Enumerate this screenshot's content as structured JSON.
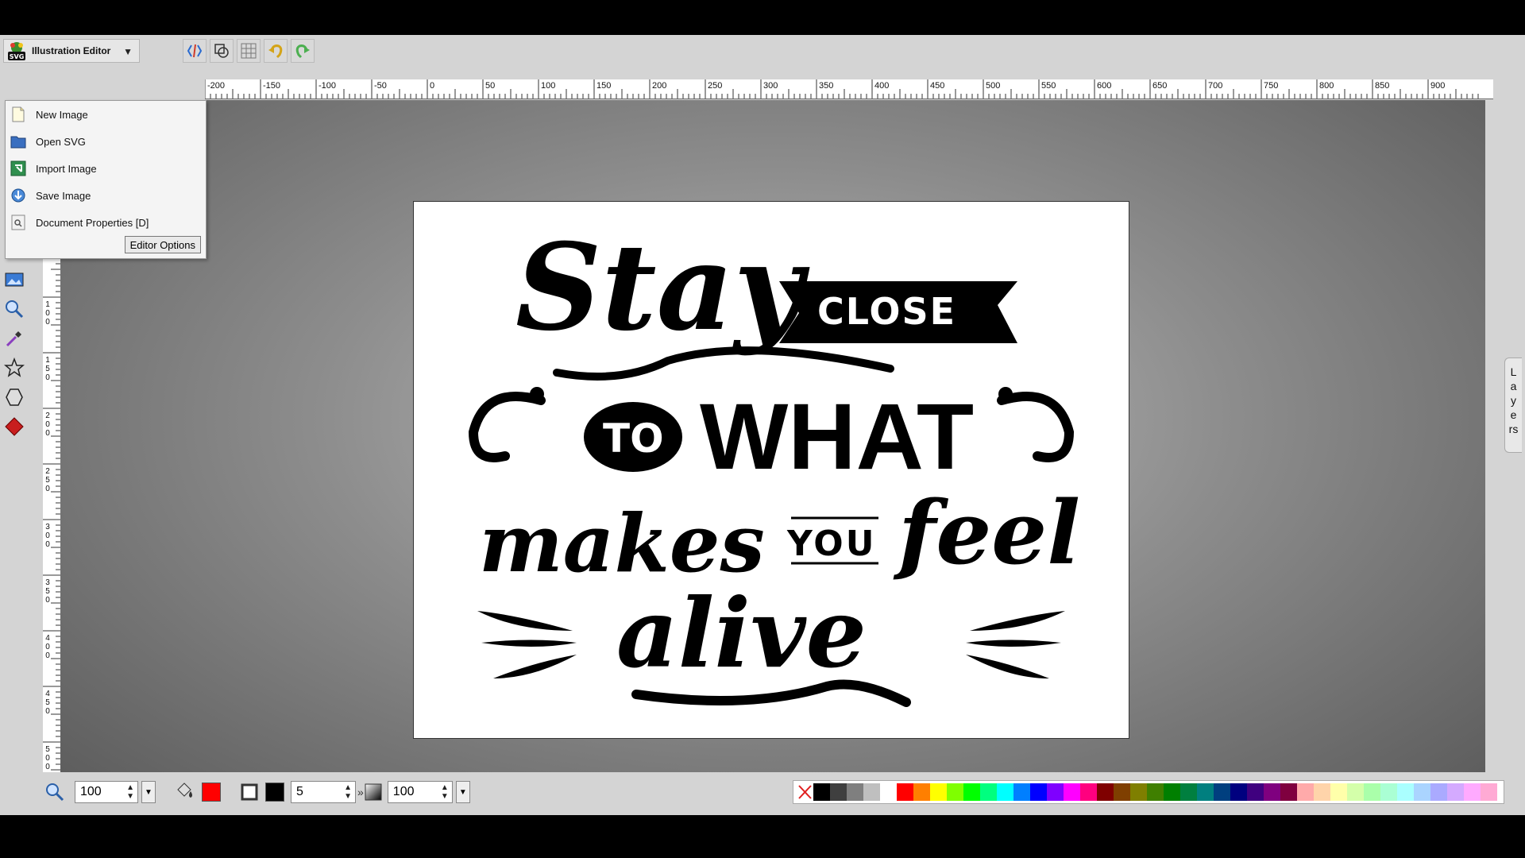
{
  "app": {
    "title": "Illustration Editor",
    "logo_text": "SVG"
  },
  "top_toolbar": {
    "buttons": [
      "source-icon",
      "wireframe-icon",
      "grid-icon",
      "undo-icon",
      "redo-icon"
    ]
  },
  "menu": {
    "items": [
      {
        "label": "New Image",
        "icon": "new-image-icon"
      },
      {
        "label": "Open SVG",
        "icon": "open-folder-icon"
      },
      {
        "label": "Import Image",
        "icon": "import-icon"
      },
      {
        "label": "Save Image",
        "icon": "save-icon"
      },
      {
        "label": "Document Properties [D]",
        "icon": "document-properties-icon"
      }
    ],
    "editor_options_label": "Editor Options"
  },
  "hruler_labels": [
    "-200",
    "-150",
    "-100",
    "-50",
    "0",
    "50",
    "100",
    "150",
    "200",
    "250",
    "300",
    "350",
    "400",
    "450",
    "500",
    "550",
    "600",
    "650",
    "700",
    "750",
    "800",
    "850",
    "900"
  ],
  "vruler_labels": [
    "100",
    "150",
    "200",
    "250",
    "300",
    "350",
    "400",
    "450",
    "500"
  ],
  "canvas": {
    "lettering": {
      "line1a": "Stay",
      "line1b": "CLOSE",
      "line2a": "TO",
      "line2b": "WHAT",
      "line3a": "makes",
      "line3b": "YOU",
      "line3c": "feel",
      "line4": "alive"
    }
  },
  "layers_label": "Layers",
  "bottom_bar": {
    "zoom_value": "100",
    "fill_color": "#ff0000",
    "stroke_color": "#000000",
    "stroke_width": "5",
    "opacity_value": "100"
  },
  "palette": [
    "none",
    "#000000",
    "#3f3f3f",
    "#7f7f7f",
    "#bfbfbf",
    "#ffffff",
    "#ff0000",
    "#ff7f00",
    "#ffff00",
    "#7fff00",
    "#00ff00",
    "#00ff7f",
    "#00ffff",
    "#007fff",
    "#0000ff",
    "#7f00ff",
    "#ff00ff",
    "#ff007f",
    "#7f0000",
    "#7f3f00",
    "#7f7f00",
    "#3f7f00",
    "#007f00",
    "#007f3f",
    "#007f7f",
    "#003f7f",
    "#00007f",
    "#3f007f",
    "#7f007f",
    "#7f003f",
    "#ffaaaa",
    "#ffd4aa",
    "#ffffaa",
    "#d4ffaa",
    "#aaffaa",
    "#aaffd4",
    "#aaffff",
    "#aad4ff",
    "#aaaaff",
    "#d4aaff",
    "#ffaaff",
    "#ffaad4"
  ]
}
